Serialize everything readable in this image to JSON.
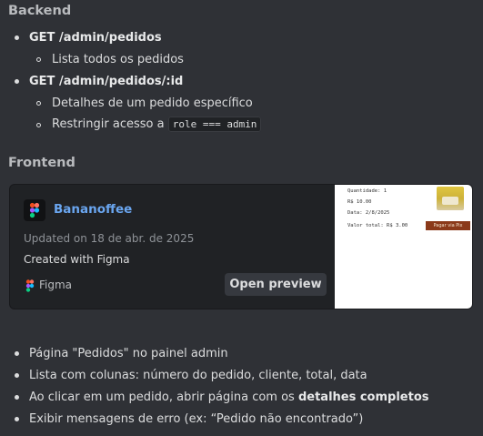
{
  "backend": {
    "heading": "Backend",
    "items": [
      {
        "label": "GET /admin/pedidos",
        "sub": [
          "Lista todos os pedidos"
        ]
      },
      {
        "label": "GET /admin/pedidos/:id",
        "sub": [
          "Detalhes de um pedido específico",
          "Restringir acesso a"
        ]
      }
    ],
    "restrict_code": "role === admin"
  },
  "frontend": {
    "heading": "Frontend",
    "embed": {
      "title": "Bananoffee",
      "updated": "Updated on 18 de abr. de 2025",
      "created": "Created with Figma",
      "source": "Figma",
      "button": "Open preview",
      "thumbnail": {
        "lines": [
          "Quantidade: 1",
          "R$ 10.00",
          "Data: 2/8/2025",
          "Valor total: R$ 3.00"
        ],
        "pay_button": "Pagar via Pix"
      }
    },
    "bullets": [
      {
        "text": "Página \"Pedidos\" no painel admin"
      },
      {
        "text": "Lista com colunas: número do pedido, cliente, total, data"
      },
      {
        "text_before": "Ao clicar em um pedido, abrir página com os ",
        "bold": "detalhes completos"
      },
      {
        "text": "Exibir mensagens de erro (ex: “Pedido não encontrado”)"
      }
    ]
  },
  "colors": {
    "background": "#2f3136",
    "link": "#6aa6f0",
    "card": "#202225"
  }
}
